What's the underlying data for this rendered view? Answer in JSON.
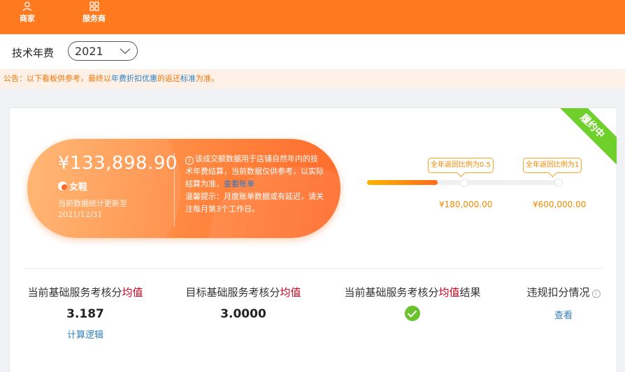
{
  "topnav": {
    "merchant_label": "商家",
    "provider_label": "服务商"
  },
  "yearbar": {
    "label": "技术年费",
    "selected_year": "2021"
  },
  "notice": {
    "prefix": "公告：以下看板供参考，最终以",
    "link_text": "年费折扣优惠",
    "middle": "的返还",
    "highlight": "标准",
    "suffix": "为准。"
  },
  "card": {
    "status_ribbon": "履约中",
    "amount": "¥133,898.90",
    "shop_name": "女鞋",
    "update_text": "当前数据统计更新至",
    "update_date": "2021/12/31",
    "info_text_1": "该成交额数据用于店铺自然年内的技术年费结算，当前数据仅供参考，以实际结算为准，",
    "info_link": "查看账单",
    "info_text_2": "温馨提示：月度账单数据或有延迟，请关注每月第3个工作日。",
    "progress_fraction": 0.36,
    "tiers": [
      {
        "tag": "全年返回比例为0.5",
        "amount": "¥180,000.00"
      },
      {
        "tag": "全年返回比例为1",
        "amount": "¥600,000.00"
      }
    ]
  },
  "metrics": {
    "current_title": "当前基础服务考核分",
    "current_title_red": "均值",
    "current_value": "3.187",
    "current_link": "计算逻辑",
    "target_title": "目标基础服务考核分",
    "target_title_red": "均值",
    "target_value": "3.0000",
    "result_title": "当前基础服务考核分",
    "result_title_red": "均值",
    "result_title_suffix": "结果",
    "violation_title": "违规扣分情况",
    "violation_link": "查看"
  }
}
